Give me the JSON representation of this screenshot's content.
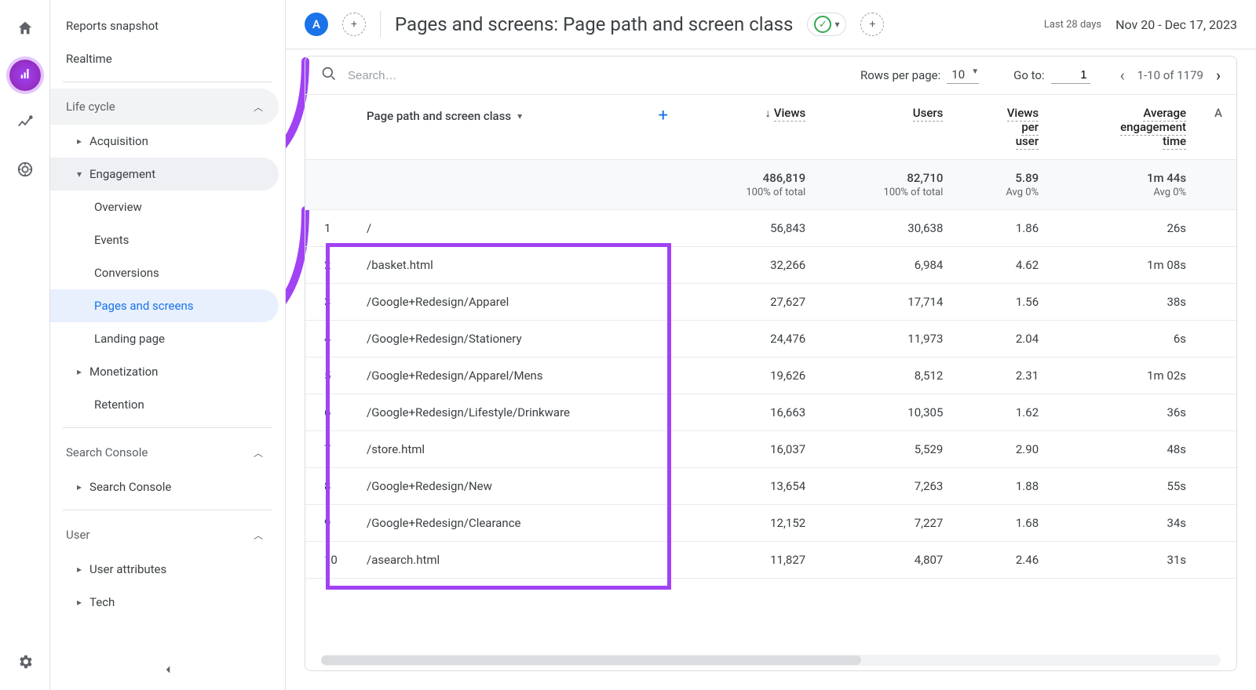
{
  "rail": {
    "home": "home",
    "reports": "reports",
    "explore": "explore",
    "advertising": "advertising",
    "settings": "settings"
  },
  "sidebar": {
    "reports_snapshot": "Reports snapshot",
    "realtime": "Realtime",
    "groups": {
      "lifecycle": {
        "label": "Life cycle"
      },
      "search_console": {
        "label": "Search Console"
      },
      "user": {
        "label": "User"
      }
    },
    "lifecycle_items": {
      "acquisition": "Acquisition",
      "engagement": "Engagement",
      "monetization": "Monetization",
      "retention": "Retention"
    },
    "engagement_items": {
      "overview": "Overview",
      "events": "Events",
      "conversions": "Conversions",
      "pages_screens": "Pages and screens",
      "landing_page": "Landing page"
    },
    "search_console_items": {
      "search_console": "Search Console"
    },
    "user_items": {
      "user_attributes": "User attributes",
      "tech": "Tech"
    }
  },
  "header": {
    "account_chip": "A",
    "title": "Pages and screens: Page path and screen class",
    "date_label": "Last 28 days",
    "date_range": "Nov 20 - Dec 17, 2023"
  },
  "toolbar": {
    "search_placeholder": "Search…",
    "rows_per_page_label": "Rows per page:",
    "rows_per_page_value": "10",
    "goto_label": "Go to:",
    "goto_value": "1",
    "page_range": "1-10 of 1179"
  },
  "table": {
    "dimension_label": "Page path and screen class",
    "columns": {
      "views": "Views",
      "users": "Users",
      "vpu1": "Views",
      "vpu2": "per",
      "vpu3": "user",
      "aet1": "Average",
      "aet2": "engagement",
      "aet3": "time",
      "extra": "A"
    },
    "summary": {
      "views": "486,819",
      "views_sub": "100% of total",
      "users": "82,710",
      "users_sub": "100% of total",
      "vpu": "5.89",
      "vpu_sub": "Avg 0%",
      "aet": "1m 44s",
      "aet_sub": "Avg 0%"
    },
    "rows": [
      {
        "idx": "1",
        "path": "/",
        "views": "56,843",
        "users": "30,638",
        "vpu": "1.86",
        "aet": "26s"
      },
      {
        "idx": "2",
        "path": "/basket.html",
        "views": "32,266",
        "users": "6,984",
        "vpu": "4.62",
        "aet": "1m 08s"
      },
      {
        "idx": "3",
        "path": "/Google+Redesign/Apparel",
        "views": "27,627",
        "users": "17,714",
        "vpu": "1.56",
        "aet": "38s"
      },
      {
        "idx": "4",
        "path": "/Google+Redesign/Stationery",
        "views": "24,476",
        "users": "11,973",
        "vpu": "2.04",
        "aet": "6s"
      },
      {
        "idx": "5",
        "path": "/Google+Redesign/Apparel/Mens",
        "views": "19,626",
        "users": "8,512",
        "vpu": "2.31",
        "aet": "1m 02s"
      },
      {
        "idx": "6",
        "path": "/Google+Redesign/Lifestyle/Drinkware",
        "views": "16,663",
        "users": "10,305",
        "vpu": "1.62",
        "aet": "36s"
      },
      {
        "idx": "7",
        "path": "/store.html",
        "views": "16,037",
        "users": "5,529",
        "vpu": "2.90",
        "aet": "48s"
      },
      {
        "idx": "8",
        "path": "/Google+Redesign/New",
        "views": "13,654",
        "users": "7,263",
        "vpu": "1.88",
        "aet": "55s"
      },
      {
        "idx": "9",
        "path": "/Google+Redesign/Clearance",
        "views": "12,152",
        "users": "7,227",
        "vpu": "1.68",
        "aet": "34s"
      },
      {
        "idx": "10",
        "path": "/asearch.html",
        "views": "11,827",
        "users": "4,807",
        "vpu": "2.46",
        "aet": "31s"
      }
    ]
  }
}
